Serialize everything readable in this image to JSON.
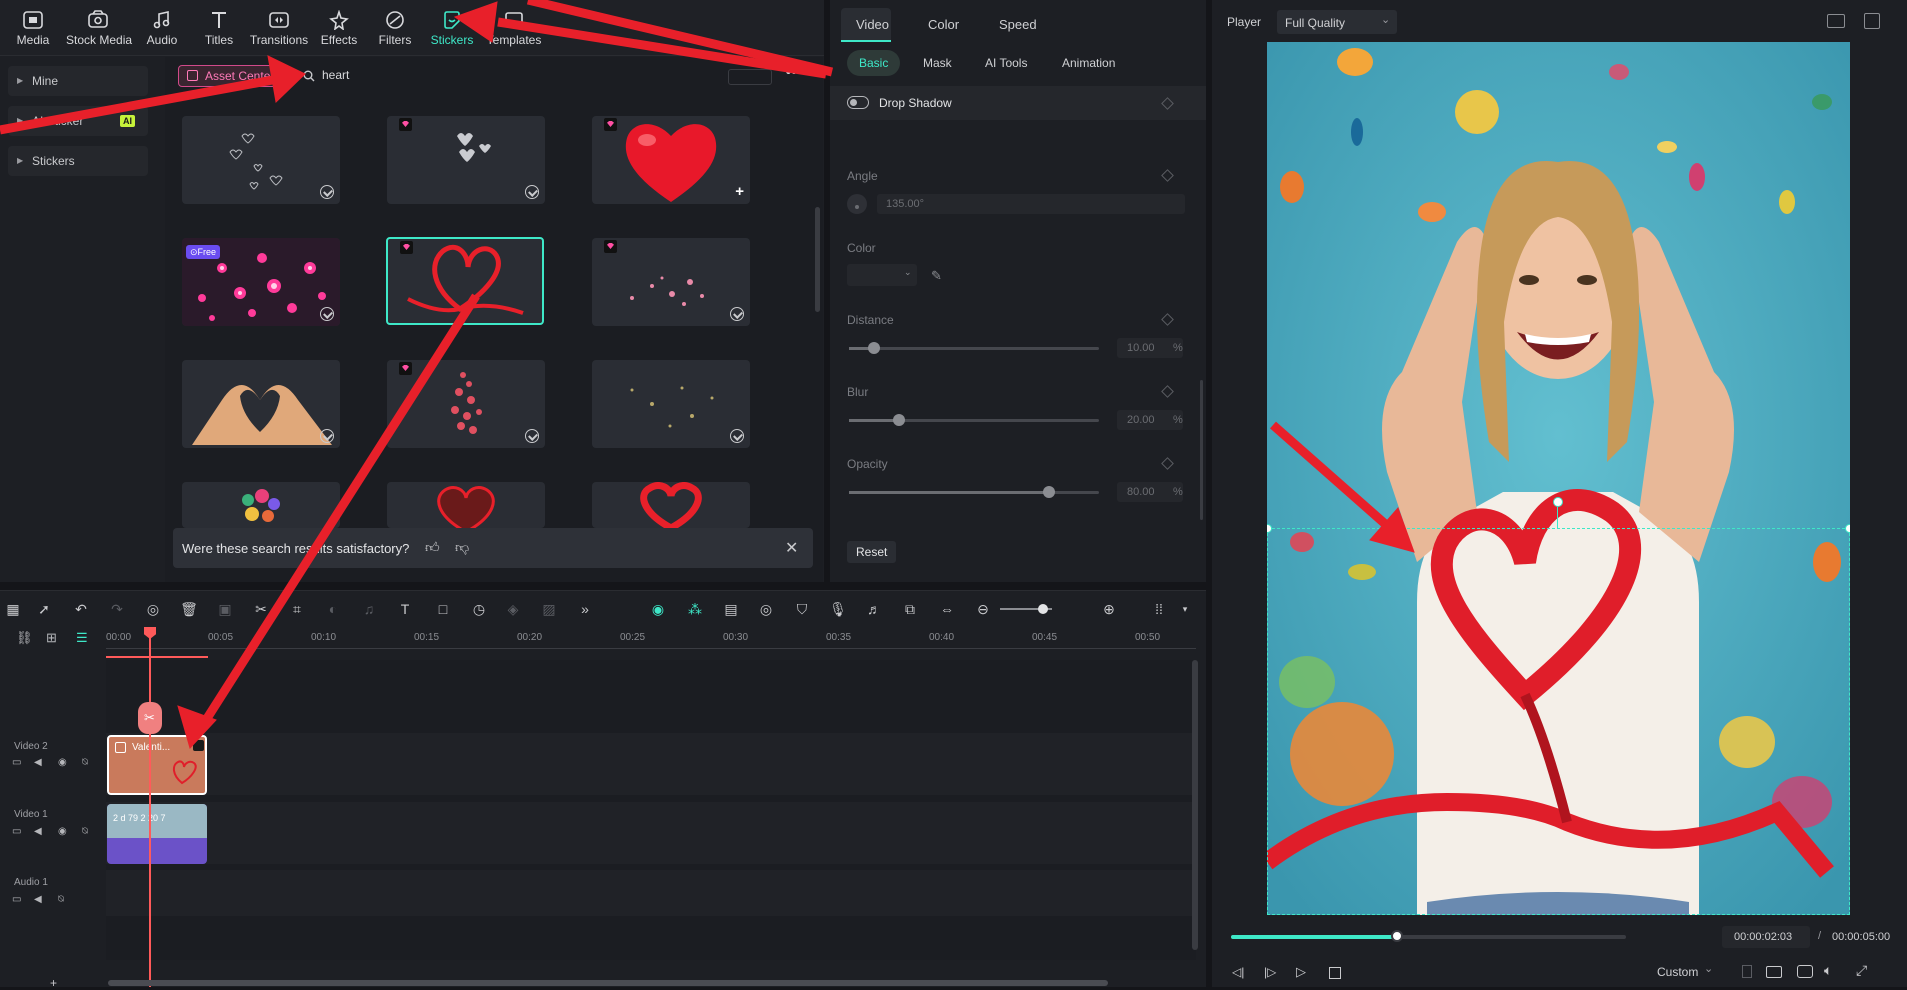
{
  "toolbar": {
    "items": [
      {
        "label": "Media",
        "icon": "media-icon"
      },
      {
        "label": "Stock Media",
        "icon": "stock-media-icon"
      },
      {
        "label": "Audio",
        "icon": "audio-icon"
      },
      {
        "label": "Titles",
        "icon": "titles-icon"
      },
      {
        "label": "Transitions",
        "icon": "transitions-icon"
      },
      {
        "label": "Effects",
        "icon": "effects-icon"
      },
      {
        "label": "Filters",
        "icon": "filters-icon"
      },
      {
        "label": "Stickers",
        "icon": "stickers-icon",
        "active": true
      },
      {
        "label": "Templates",
        "icon": "templates-icon"
      }
    ]
  },
  "sidebar": {
    "items": [
      {
        "label": "Mine"
      },
      {
        "label": "AI Sticker",
        "badge": "AI"
      },
      {
        "label": "Stickers"
      }
    ]
  },
  "search": {
    "asset_center_label": "Asset Center",
    "query": "heart"
  },
  "stickers_grid": {
    "free_badge": "Free"
  },
  "survey": {
    "question": "Were these search results satisfactory?"
  },
  "props": {
    "tabs": [
      "Video",
      "Color",
      "Speed"
    ],
    "subtabs": [
      "Basic",
      "Mask",
      "AI Tools",
      "Animation"
    ],
    "drop_shadow_label": "Drop Shadow",
    "angle_label": "Angle",
    "angle_value": "135.00°",
    "color_label": "Color",
    "distance_label": "Distance",
    "distance_value": "10.00",
    "distance_level": 0.1,
    "blur_label": "Blur",
    "blur_value": "20.00",
    "blur_level": 0.2,
    "opacity_label": "Opacity",
    "opacity_value": "80.00",
    "opacity_level": 0.8,
    "percent_unit": "%",
    "reset_label": "Reset"
  },
  "player": {
    "label": "Player",
    "quality": "Full Quality",
    "current_time": "00:00:02:03",
    "separator": "/",
    "total_time": "00:00:05:00",
    "progress": 0.42,
    "zoom_option": "Custom"
  },
  "timeline": {
    "ruler": [
      "00:00",
      "00:05",
      "00:10",
      "00:15",
      "00:20",
      "00:25",
      "00:30",
      "00:35",
      "00:40",
      "00:45",
      "00:50"
    ],
    "tracks": [
      {
        "name": "Video 2"
      },
      {
        "name": "Video 1"
      },
      {
        "name": "Audio 1"
      }
    ],
    "clip_video2_label": "Valenti...",
    "clip_video1_label": "2 d 79 2 20 7"
  },
  "colors": {
    "accent": "#3ee8c8",
    "arrow": "#e8202a",
    "clip_video2": "#c97a5c",
    "clip_video1": "#6b52c8",
    "playhead": "#ff5a5a"
  }
}
